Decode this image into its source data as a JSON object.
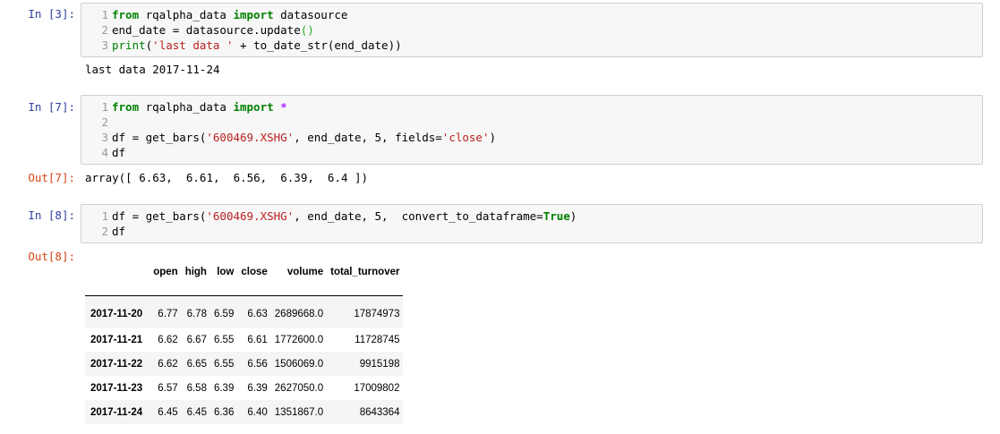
{
  "cells": [
    {
      "in_prompt": "In [3]:",
      "lines": [
        {
          "n": "1",
          "tokens": [
            [
              "kw",
              "from"
            ],
            [
              "t",
              " rqalpha_data "
            ],
            [
              "kw",
              "import"
            ],
            [
              "t",
              " datasource"
            ]
          ]
        },
        {
          "n": "2",
          "tokens": [
            [
              "t",
              "end_date "
            ],
            [
              "t",
              "="
            ],
            [
              "t",
              " datasource.update"
            ],
            [
              "paren",
              "()"
            ]
          ]
        },
        {
          "n": "3",
          "tokens": [
            [
              "bi",
              "print"
            ],
            [
              "t",
              "("
            ],
            [
              "str",
              "'last data '"
            ],
            [
              "t",
              " "
            ],
            [
              "t",
              "+"
            ],
            [
              "t",
              " to_date_str(end_date))"
            ]
          ]
        }
      ],
      "stdout": "last data 2017-11-24"
    },
    {
      "in_prompt": "In [7]:",
      "lines": [
        {
          "n": "1",
          "tokens": [
            [
              "kw",
              "from"
            ],
            [
              "t",
              " rqalpha_data "
            ],
            [
              "kw",
              "import"
            ],
            [
              "t",
              " "
            ],
            [
              "op",
              "*"
            ]
          ]
        },
        {
          "n": "2",
          "tokens": []
        },
        {
          "n": "3",
          "tokens": [
            [
              "t",
              "df "
            ],
            [
              "t",
              "="
            ],
            [
              "t",
              " get_bars("
            ],
            [
              "str",
              "'600469.XSHG'"
            ],
            [
              "t",
              ", end_date, 5, fields"
            ],
            [
              "t",
              "="
            ],
            [
              "str",
              "'close'"
            ],
            [
              "t",
              ")"
            ]
          ]
        },
        {
          "n": "4",
          "tokens": [
            [
              "t",
              "df"
            ]
          ]
        }
      ],
      "out_prompt": "Out[7]:",
      "out_text": "array([ 6.63,  6.61,  6.56,  6.39,  6.4 ])"
    },
    {
      "in_prompt": "In [8]:",
      "lines": [
        {
          "n": "1",
          "tokens": [
            [
              "t",
              "df "
            ],
            [
              "t",
              "="
            ],
            [
              "t",
              " get_bars("
            ],
            [
              "str",
              "'600469.XSHG'"
            ],
            [
              "t",
              ", end_date, 5,  convert_to_dataframe"
            ],
            [
              "t",
              "="
            ],
            [
              "cst",
              "True"
            ],
            [
              "t",
              ")"
            ]
          ]
        },
        {
          "n": "2",
          "tokens": [
            [
              "t",
              "df"
            ]
          ]
        }
      ],
      "out_prompt": "Out[8]:",
      "table": {
        "columns": [
          "",
          "open",
          "high",
          "low",
          "close",
          "volume",
          "total_turnover"
        ],
        "rows": [
          [
            "2017-11-20",
            "6.77",
            "6.78",
            "6.59",
            "6.63",
            "2689668.0",
            "17874973"
          ],
          [
            "2017-11-21",
            "6.62",
            "6.67",
            "6.55",
            "6.61",
            "1772600.0",
            "11728745"
          ],
          [
            "2017-11-22",
            "6.62",
            "6.65",
            "6.55",
            "6.56",
            "1506069.0",
            "9915198"
          ],
          [
            "2017-11-23",
            "6.57",
            "6.58",
            "6.39",
            "6.39",
            "2627050.0",
            "17009802"
          ],
          [
            "2017-11-24",
            "6.45",
            "6.45",
            "6.36",
            "6.40",
            "1351867.0",
            "8643364"
          ]
        ]
      }
    }
  ]
}
